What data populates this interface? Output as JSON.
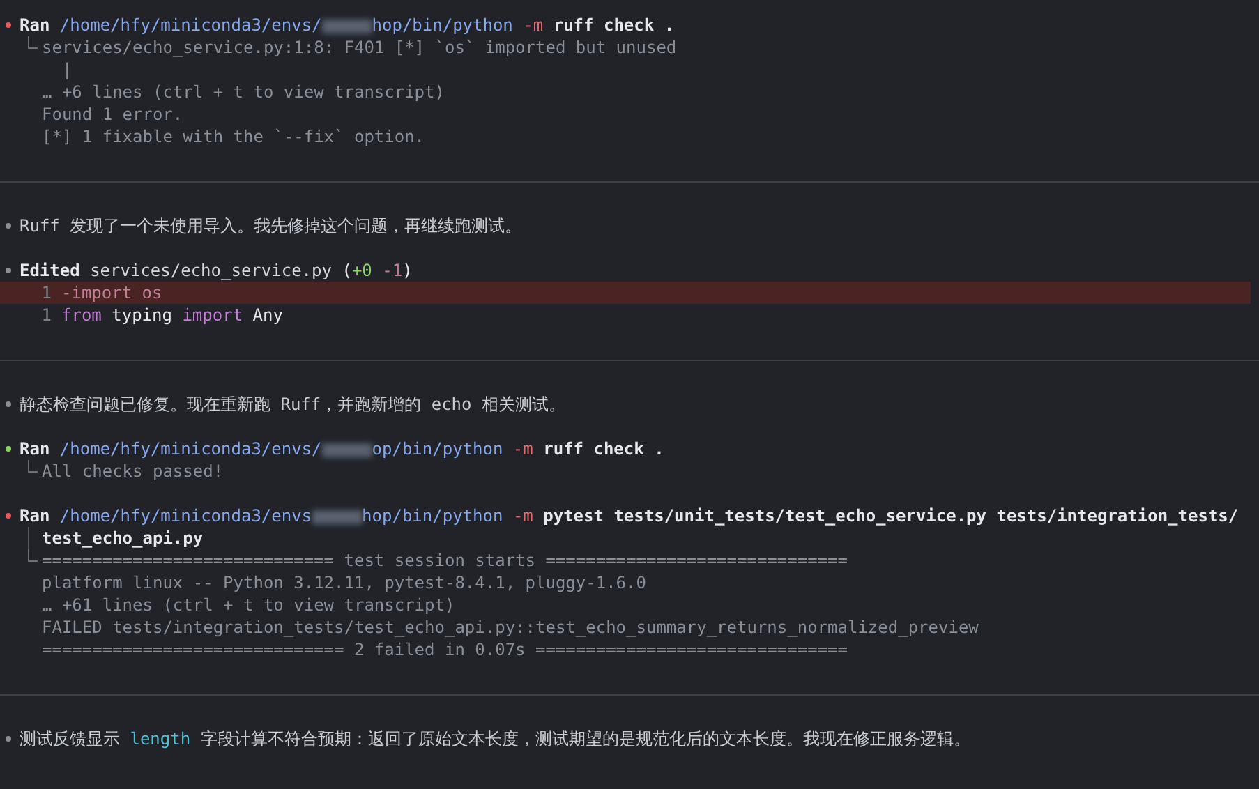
{
  "blocks": [
    {
      "kind": "command",
      "color": "#e55a5a",
      "verb": "Ran",
      "path_before": "/home/hfy/miniconda3/envs/",
      "path_after": "hop/bin/python",
      "flag": "-m",
      "args": "ruff check .",
      "output": [
        "services/echo_service.py:1:8: F401 [*] `os` imported but unused",
        "  |",
        "… +6 lines (ctrl + t to view transcript)",
        "Found 1 error.",
        "[*] 1 fixable with the `--fix` option."
      ]
    },
    {
      "kind": "divider"
    },
    {
      "kind": "message",
      "color": "#8a8e96",
      "segments": [
        {
          "text": "Ruff 发现了一个未使用导入。我先修掉这个问题，再继续跑测试。",
          "code": false
        }
      ]
    },
    {
      "kind": "edit",
      "color": "#8a8e96",
      "verb": "Edited",
      "file": "services/echo_service.py",
      "summary": [
        {
          "text": "(",
          "kind": "plain"
        },
        {
          "text": "+0",
          "kind": "added"
        },
        {
          "text": " -1",
          "kind": "removed"
        },
        {
          "text": ")",
          "kind": "plain"
        }
      ],
      "lines": [
        {
          "number": "1",
          "removed": true,
          "tokens": [
            {
              "text": "-import os",
              "kind": "removed"
            }
          ]
        },
        {
          "number": "1",
          "removed": false,
          "tokens": [
            {
              "text": "from",
              "kind": "keyword"
            },
            {
              "text": " typing ",
              "kind": "plain"
            },
            {
              "text": "import",
              "kind": "keyword"
            },
            {
              "text": " Any",
              "kind": "plain"
            }
          ]
        }
      ]
    },
    {
      "kind": "divider"
    },
    {
      "kind": "message",
      "color": "#8a8e96",
      "segments": [
        {
          "text": "静态检查问题已修复。现在重新跑 Ruff，并跑新增的 echo 相关测试。",
          "code": false
        }
      ]
    },
    {
      "kind": "command",
      "color": "#8bd26a",
      "verb": "Ran",
      "path_before": "/home/hfy/miniconda3/envs/",
      "path_after": "op/bin/python",
      "flag": "-m",
      "args": "ruff check .",
      "output": [
        "All checks passed!"
      ]
    },
    {
      "kind": "command",
      "color": "#e55a5a",
      "verb": "Ran",
      "path_before": "/home/hfy/miniconda3/envs",
      "path_after": "hop/bin/python",
      "flag": "-m",
      "args": "pytest tests/unit_tests/test_echo_service.py tests/integration_tests/",
      "continuation": "test_echo_api.py",
      "output": [
        "============================= test session starts ==============================",
        "platform linux -- Python 3.12.11, pytest-8.4.1, pluggy-1.6.0",
        "… +61 lines (ctrl + t to view transcript)",
        "FAILED tests/integration_tests/test_echo_api.py::test_echo_summary_returns_normalized_preview",
        "============================== 2 failed in 0.07s ==============================="
      ]
    },
    {
      "kind": "divider"
    },
    {
      "kind": "message",
      "color": "#8a8e96",
      "segments": [
        {
          "text": "测试反馈显示 ",
          "code": false
        },
        {
          "text": "length",
          "code": true
        },
        {
          "text": " 字段计算不符合预期：返回了原始文本长度，测试期望的是规范化后的文本长度。我现在修正服务逻辑。",
          "code": false
        }
      ]
    }
  ]
}
